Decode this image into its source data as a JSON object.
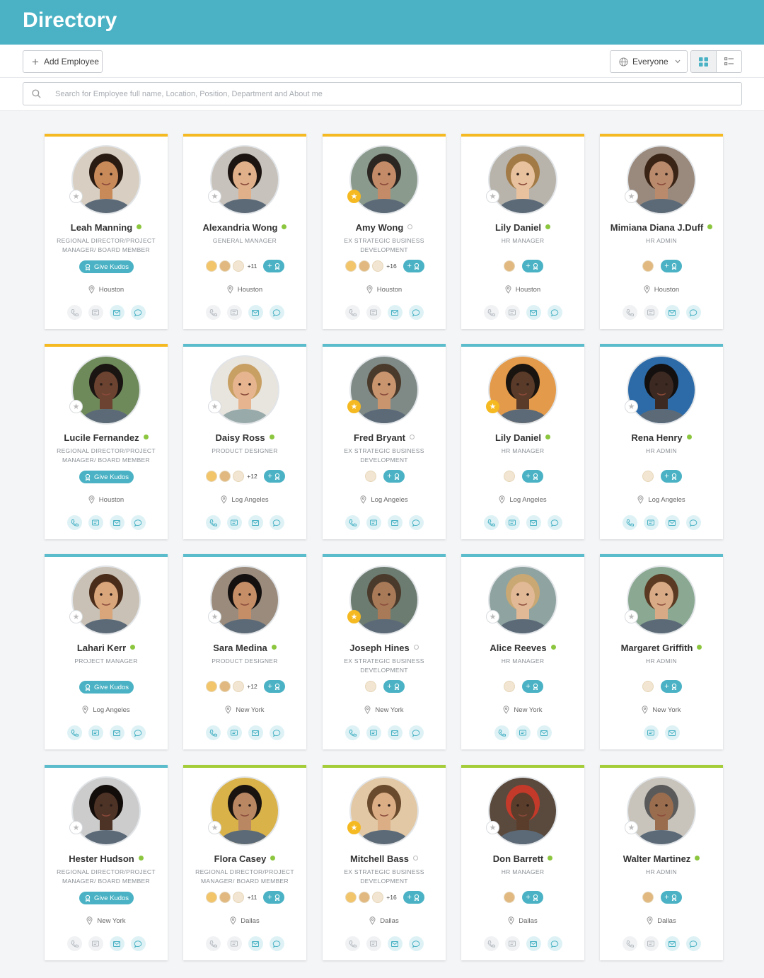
{
  "app": {
    "title": "Directory"
  },
  "toolbar": {
    "add_label": "Add Employee",
    "filter_label": "Everyone",
    "search_placeholder": "Search for Employee full name, Location, Position, Department and About me"
  },
  "kudos_label": "Give Kudos",
  "employees": [
    {
      "name": "Leah Manning",
      "title": "Regional Director/Project Manager/ Board Member",
      "location": "Houston",
      "online": true,
      "starred": false,
      "accent": "gold",
      "kudos_button": true,
      "badges": [],
      "more": ""
    },
    {
      "name": "Alexandria Wong",
      "title": "General Manager",
      "location": "Houston",
      "online": true,
      "starred": false,
      "accent": "gold",
      "kudos_button": false,
      "badges": [
        "burger-badge",
        "cookie-badge",
        "monkey-badge"
      ],
      "more": "+11"
    },
    {
      "name": "Amy Wong",
      "title": "Ex Strategic Business Development",
      "location": "Houston",
      "online": false,
      "starred": true,
      "accent": "gold",
      "kudos_button": false,
      "badges": [
        "burger-badge",
        "cookie-badge",
        "monkey-badge"
      ],
      "more": "+16"
    },
    {
      "name": "Lily Daniel",
      "title": "HR Manager",
      "location": "Houston",
      "online": true,
      "starred": false,
      "accent": "gold",
      "kudos_button": false,
      "badges": [
        "cookie-badge"
      ],
      "more": ""
    },
    {
      "name": "Mimiana Diana J.Duff",
      "title": "HR Admin",
      "location": "Houston",
      "online": true,
      "starred": false,
      "accent": "gold",
      "kudos_button": false,
      "badges": [
        "cookie-badge"
      ],
      "more": ""
    },
    {
      "name": "Lucile Fernandez",
      "title": "Regional Director/Project Manager/ Board Member",
      "location": "Houston",
      "online": true,
      "starred": false,
      "accent": "gold",
      "kudos_button": true,
      "badges": [],
      "more": ""
    },
    {
      "name": "Daisy Ross",
      "title": "Product Designer",
      "location": "Log Angeles",
      "online": true,
      "starred": false,
      "accent": "teal",
      "kudos_button": false,
      "badges": [
        "burger-badge",
        "cookie-badge",
        "monkey-badge"
      ],
      "more": "+12"
    },
    {
      "name": "Fred Bryant",
      "title": "Ex Strategic Business Development",
      "location": "Log Angeles",
      "online": false,
      "starred": true,
      "accent": "teal",
      "kudos_button": false,
      "badges": [
        "monkey-badge"
      ],
      "more": ""
    },
    {
      "name": "Lily Daniel",
      "title": "HR Manager",
      "location": "Log Angeles",
      "online": true,
      "starred": true,
      "accent": "teal",
      "kudos_button": false,
      "badges": [
        "monkey-badge"
      ],
      "more": ""
    },
    {
      "name": "Rena Henry",
      "title": "HR Admin",
      "location": "Log Angeles",
      "online": true,
      "starred": false,
      "accent": "teal",
      "kudos_button": false,
      "badges": [
        "monkey-badge"
      ],
      "more": ""
    },
    {
      "name": "Lahari Kerr",
      "title": "Project Manager",
      "location": "Log Angeles",
      "online": true,
      "starred": false,
      "accent": "teal",
      "kudos_button": true,
      "badges": [],
      "more": ""
    },
    {
      "name": "Sara Medina",
      "title": "Product Designer",
      "location": "New York",
      "online": true,
      "starred": false,
      "accent": "teal",
      "kudos_button": false,
      "badges": [
        "burger-badge",
        "cookie-badge",
        "monkey-badge"
      ],
      "more": "+12"
    },
    {
      "name": "Joseph Hines",
      "title": "Ex Strategic Business Development",
      "location": "New York",
      "online": false,
      "starred": true,
      "accent": "teal",
      "kudos_button": false,
      "badges": [
        "monkey-badge"
      ],
      "more": ""
    },
    {
      "name": "Alice Reeves",
      "title": "HR Manager",
      "location": "New York",
      "online": true,
      "starred": false,
      "accent": "teal",
      "kudos_button": false,
      "badges": [
        "monkey-badge"
      ],
      "more": ""
    },
    {
      "name": "Margaret Griffith",
      "title": "HR Admin",
      "location": "New York",
      "online": true,
      "starred": false,
      "accent": "teal",
      "kudos_button": false,
      "badges": [
        "monkey-badge"
      ],
      "more": ""
    },
    {
      "name": "Hester Hudson",
      "title": "Regional Director/Project Manager/ Board Member",
      "location": "New York",
      "online": true,
      "starred": false,
      "accent": "teal",
      "kudos_button": true,
      "badges": [],
      "more": ""
    },
    {
      "name": "Flora Casey",
      "title": "Regional Director/Project Manager/ Board Member",
      "location": "Dallas",
      "online": true,
      "starred": false,
      "accent": "green",
      "kudos_button": false,
      "badges": [
        "burger-badge",
        "cookie-badge",
        "monkey-badge"
      ],
      "more": "+11"
    },
    {
      "name": "Mitchell Bass",
      "title": "Ex Strategic Business Development",
      "location": "Dallas",
      "online": false,
      "starred": true,
      "accent": "green",
      "kudos_button": false,
      "badges": [
        "burger-badge",
        "cookie-badge",
        "monkey-badge"
      ],
      "more": "+16"
    },
    {
      "name": "Don Barrett",
      "title": "HR Manager",
      "location": "Dallas",
      "online": true,
      "starred": false,
      "accent": "green",
      "kudos_button": false,
      "badges": [
        "cookie-badge"
      ],
      "more": ""
    },
    {
      "name": "Walter Martinez",
      "title": "HR Admin",
      "location": "Dallas",
      "online": true,
      "starred": false,
      "accent": "green",
      "kudos_button": false,
      "badges": [
        "cookie-badge"
      ],
      "more": ""
    }
  ],
  "colors": {
    "header": "#4ab2c4",
    "gold": "#f5b921",
    "teal": "#5bbccc",
    "green": "#a5cd39",
    "online": "#8cc63f"
  }
}
